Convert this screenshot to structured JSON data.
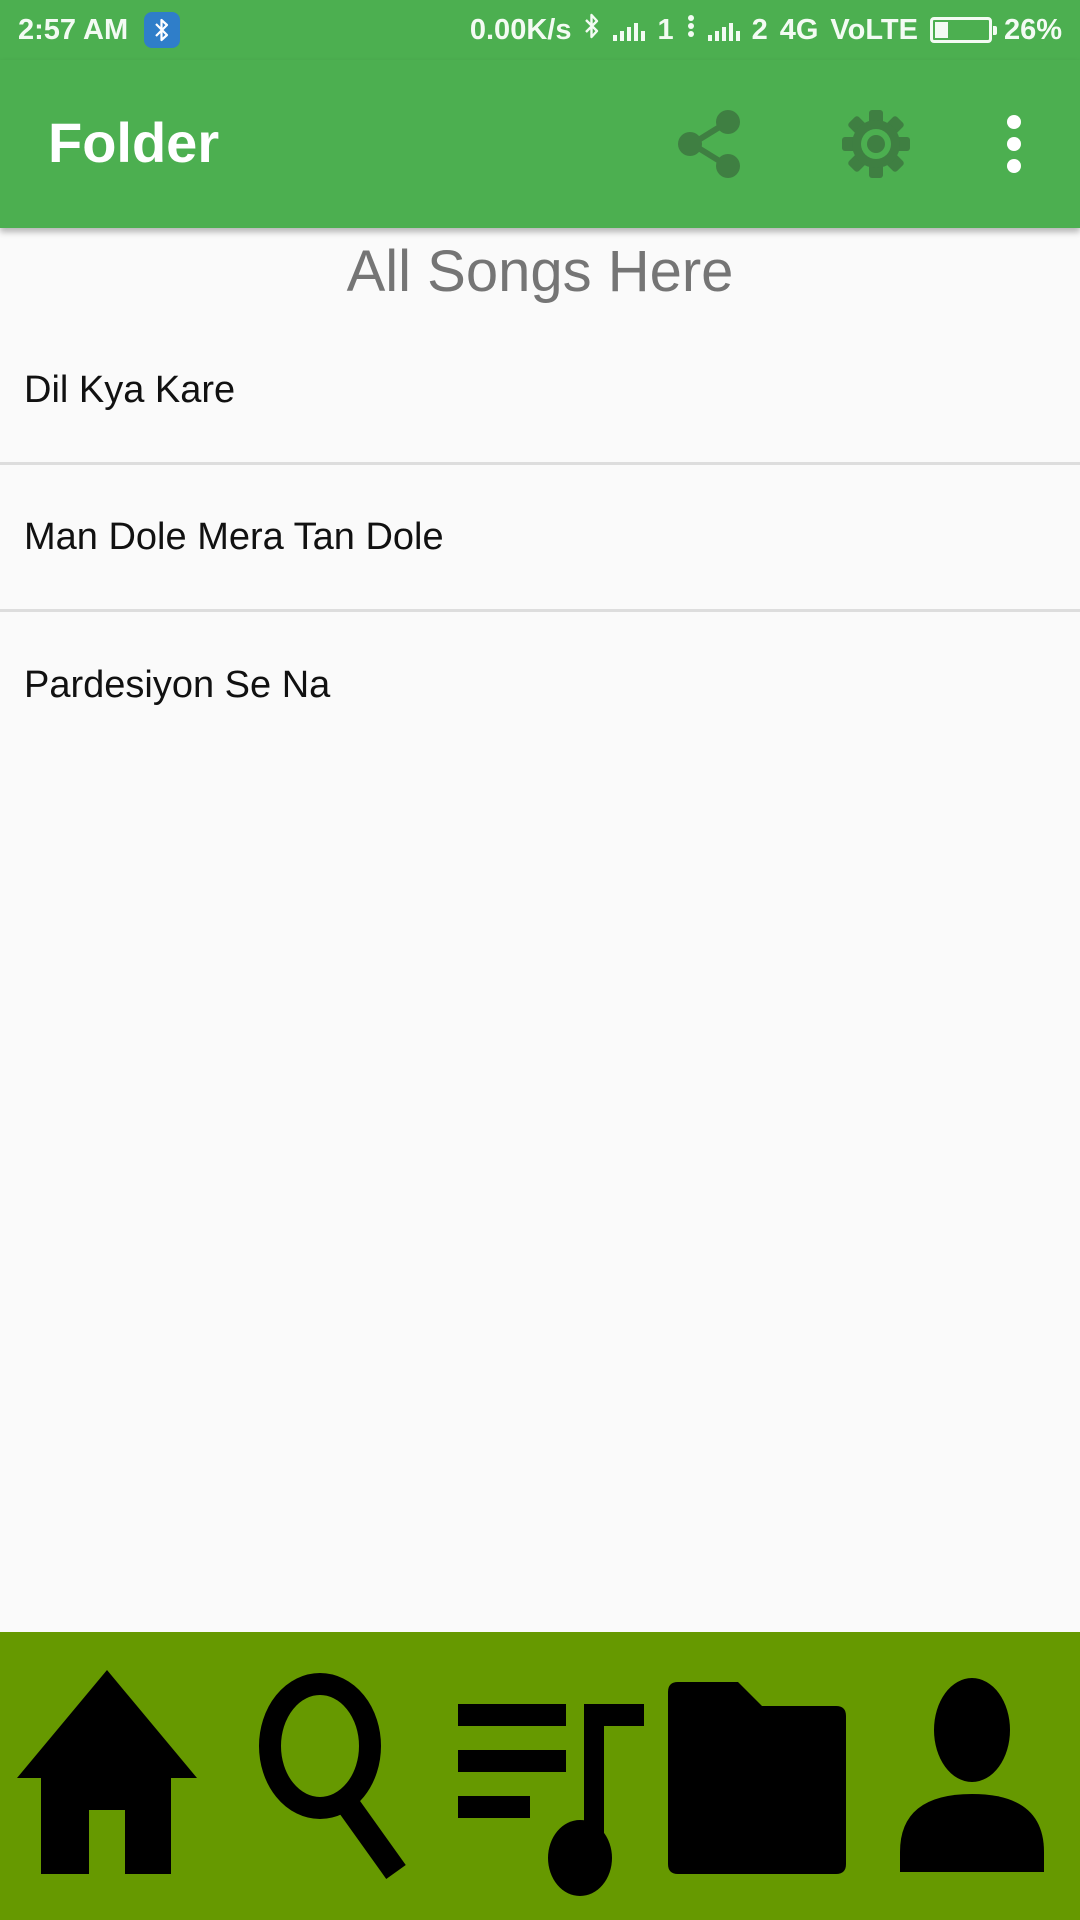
{
  "status_bar": {
    "time": "2:57 AM",
    "network_speed": "0.00K/s",
    "sim1": "1",
    "sim2": "2",
    "network_type": "4G",
    "volte": "VoLTE",
    "battery_level": 0.26,
    "battery_percent": "26%",
    "icons": [
      "bluetooth-notification-icon",
      "bluetooth-icon",
      "signal-icon",
      "battery-icon"
    ]
  },
  "app_bar": {
    "title": "Folder",
    "actions": [
      "share-icon",
      "settings-icon",
      "more-vert-icon"
    ],
    "background": "#4caf50",
    "icon_color": "#3f7f42"
  },
  "content": {
    "heading": "All Songs Here",
    "songs": [
      {
        "title": "Dil Kya Kare"
      },
      {
        "title": "Man Dole Mera Tan Dole"
      },
      {
        "title": "Pardesiyon Se Na"
      }
    ]
  },
  "bottom_nav": {
    "background": "#669900",
    "items": [
      "home-icon",
      "search-icon",
      "playlist-icon",
      "folder-icon",
      "profile-icon"
    ]
  }
}
